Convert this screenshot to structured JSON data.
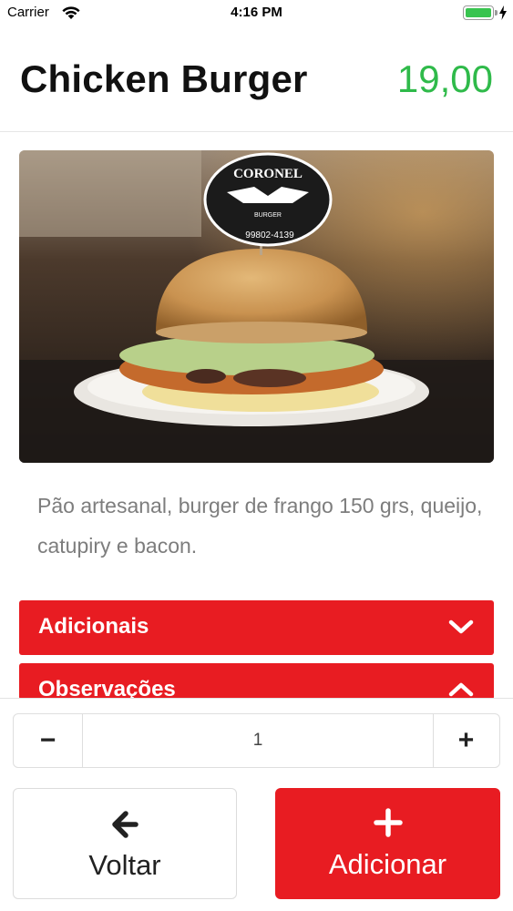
{
  "status_bar": {
    "carrier": "Carrier",
    "time": "4:16 PM",
    "battery_color": "#38c44f"
  },
  "product": {
    "title": "Chicken Burger",
    "price": "19,00",
    "price_color": "#2fba4a",
    "image_sign_brand": "CORONEL",
    "image_sign_sub": "BURGER",
    "image_sign_phone": "99802-4139",
    "description": "Pão artesanal, burger de frango 150 grs, queijo, catupiry e bacon."
  },
  "accordions": [
    {
      "label": "Adicionais",
      "icon": "chevron-down-icon"
    },
    {
      "label": "Observações",
      "icon": "chevron-up-icon"
    }
  ],
  "accent_color": "#e81c22",
  "quantity": {
    "minus_label": "−",
    "value": "1",
    "plus_label": "+"
  },
  "actions": {
    "back_label": "Voltar",
    "back_icon": "arrow-left-icon",
    "add_label": "Adicionar",
    "add_icon": "plus-icon"
  }
}
